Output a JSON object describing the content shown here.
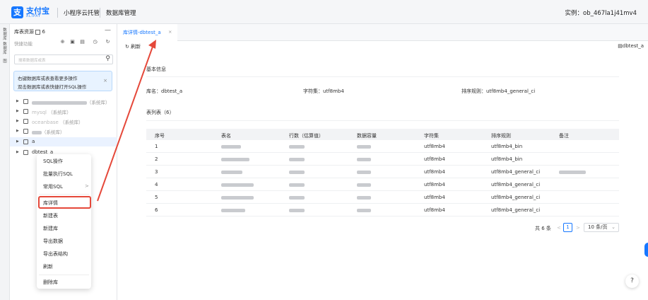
{
  "header": {
    "logo_badge": "支",
    "logo_cn": "支付宝",
    "logo_en": "ALIPAY",
    "product": "小程序云托管",
    "page": "数据库管理",
    "instance": "实例：ob_467la1j41mv4"
  },
  "rail": {
    "items": [
      "数据库",
      "数据库",
      "图"
    ]
  },
  "sidebar": {
    "title": "库表资源",
    "count": "6",
    "collapse": "—",
    "quick_label": "快捷功能",
    "search_placeholder": "搜索数据库或表",
    "tip_line1": "右键数据库或表查看更多操作",
    "tip_line2": "双击数据库或表快捷打开SQL操作",
    "tip_close": "×",
    "tree": [
      {
        "name": "",
        "suffix": "（系统库）"
      },
      {
        "name": "mysql",
        "suffix": "（系统库）"
      },
      {
        "name": "oceanbase",
        "suffix": "（系统库）"
      },
      {
        "name": "",
        "suffix": "（系统库）"
      },
      {
        "name": "a",
        "suffix": ""
      },
      {
        "name": "dbtest_a",
        "suffix": ""
      }
    ]
  },
  "context_menu": {
    "items": [
      "SQL操作",
      "批量执行SQL",
      "常用SQL",
      "库详情",
      "新建表",
      "新建库",
      "导出数据",
      "导出表结构",
      "刷新",
      "删除库"
    ],
    "submenu_arrow": ">"
  },
  "tab": {
    "label": "库详情-dbtest_a",
    "close": "×"
  },
  "toolbar": {
    "refresh": "刷新",
    "db_link": "dbtest_a"
  },
  "basic_info": {
    "title": "基本信息",
    "db_name": "库名：dbtest_a",
    "charset": "字符集：utf8mb4",
    "collation": "排序规则：utf8mb4_general_ci"
  },
  "table_list": {
    "title": "表列表（6）",
    "columns": [
      "序号",
      "表名",
      "行数（估算值）",
      "数据容量",
      "字符集",
      "排序规则",
      "备注"
    ],
    "rows": [
      [
        "1",
        "",
        "",
        "",
        "utf8mb4",
        "utf8mb4_bin",
        ""
      ],
      [
        "2",
        "",
        "",
        "",
        "utf8mb4",
        "utf8mb4_bin",
        ""
      ],
      [
        "3",
        "",
        "",
        "",
        "utf8mb4",
        "utf8mb4_general_ci",
        ""
      ],
      [
        "4",
        "",
        "",
        "",
        "utf8mb4",
        "utf8mb4_general_ci",
        ""
      ],
      [
        "5",
        "",
        "",
        "",
        "utf8mb4",
        "utf8mb4_general_ci",
        ""
      ],
      [
        "6",
        "",
        "",
        "",
        "utf8mb4",
        "utf8mb4_general_ci",
        ""
      ]
    ]
  },
  "pagination": {
    "total": "共 6 条",
    "prev": "<",
    "page": "1",
    "next": ">",
    "page_size": "10 条/页"
  },
  "help": {
    "label": "?"
  },
  "colors": {
    "accent": "#1677ff",
    "annotation": "#e5483a",
    "selected_row": "#eaf2ff"
  }
}
